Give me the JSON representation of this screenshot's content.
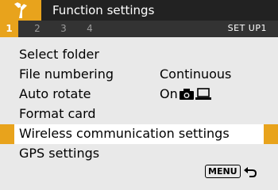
{
  "header": {
    "title": "Function settings",
    "icon": "wrench-icon",
    "accent": "#e8a31c"
  },
  "tabs": [
    {
      "label": "1",
      "active": true
    },
    {
      "label": "2",
      "active": false
    },
    {
      "label": "3",
      "active": false
    },
    {
      "label": "4",
      "active": false
    }
  ],
  "set_label": "SET UP1",
  "items": [
    {
      "label": "Select folder",
      "value": ""
    },
    {
      "label": "File numbering",
      "value": "Continuous"
    },
    {
      "label": "Auto rotate",
      "value": "On"
    },
    {
      "label": "Format card",
      "value": ""
    },
    {
      "label": "Wireless communication settings",
      "value": "",
      "selected": true
    },
    {
      "label": "GPS settings",
      "value": ""
    }
  ],
  "footer": {
    "menu_label": "MENU",
    "return_icon": "return-arrow-icon"
  }
}
